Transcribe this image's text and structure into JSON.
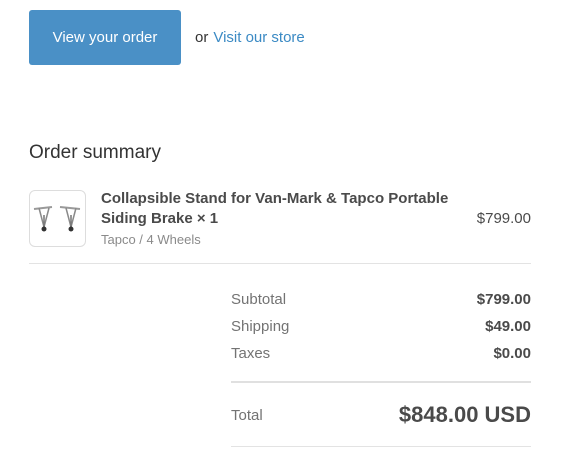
{
  "actions": {
    "view_order_label": "View your order",
    "or_text": "or",
    "store_link_label": "Visit our store"
  },
  "summary": {
    "title": "Order summary",
    "product": {
      "name": "Collapsible Stand for Van-Mark & Tapco Portable Siding Brake × 1",
      "variant": "Tapco / 4 Wheels",
      "price": "$799.00",
      "thumbnail_icon": "folding-stand-image"
    },
    "lines": [
      {
        "label": "Subtotal",
        "value": "$799.00"
      },
      {
        "label": "Shipping",
        "value": "$49.00"
      },
      {
        "label": "Taxes",
        "value": "$0.00"
      }
    ],
    "total_label": "Total",
    "total_value": "$848.00 USD"
  },
  "colors": {
    "button": "#4a90c6",
    "link": "#3b8ac4"
  }
}
